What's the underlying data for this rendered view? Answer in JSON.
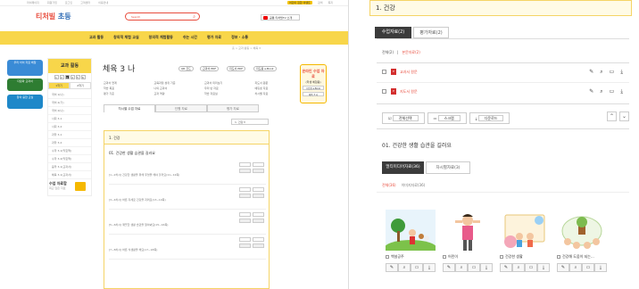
{
  "topbar": {
    "left_links": [
      "마이페이지",
      "회원가입",
      "로그인",
      "고객센터",
      "이용안내"
    ],
    "right_links": [
      "검색",
      "쪽지",
      "메일",
      "알림"
    ],
    "event": "어린이 집합 이벤트"
  },
  "logo": {
    "main": "티처빌",
    "sub": "초등"
  },
  "search": {
    "placeholder": "Search"
  },
  "youtube": {
    "label": "공통 티처빌TV 소개"
  },
  "nav": {
    "items": [
      "교과 활동",
      "창의적 체험 교실",
      "창의적 체험활동",
      "쉬는 시간",
      "평가 자료",
      "정보 · 소통"
    ]
  },
  "breadcrumb": "홈 > 교과 활동 > 체육 3",
  "promos": [
    {
      "label": "우리 아이 자료 배달"
    },
    {
      "label": "다문화 교과서"
    },
    {
      "label": "창의 융합 교실"
    }
  ],
  "side": {
    "header": "교과 활동",
    "grades": [
      "1",
      "2",
      "3",
      "4",
      "5",
      "6"
    ],
    "active_grade": "3",
    "tabs": [
      "1학기",
      "2학기"
    ],
    "items": [
      "국어 1(나)",
      "국어 2(가)",
      "국어 2(나)",
      "사회 3-1",
      "사회 3-2",
      "과학 3-1",
      "과학 3-2",
      "수학 3-1(익힘책)",
      "수학 3-2(익힘책)",
      "음악 3-1(교과서)",
      "체육 3-1(교과서)"
    ],
    "resources_title": "수업 자료함",
    "resources_sub": "최근 담은 자료"
  },
  "main": {
    "title": "체육 3 나",
    "pills": [
      "QR 코드",
      "교과서 PDF",
      "지도서 PDF",
      "지도용 e-Book"
    ],
    "meta_rows": [
      [
        "교과서 연계",
        "교육과정 성취 기준",
        "교과서 미리보기",
        "지도서 원문"
      ],
      [
        "학습 목표",
        "나의 교과서",
        "우리 반 자료",
        "에듀넷 자료"
      ],
      [
        "평가 기준",
        "교과 역량",
        "학습 자료실",
        "차시별 자료"
      ]
    ],
    "lesson_box": {
      "title": "온라인 수업 자료",
      "sub": "(학생 체험용)",
      "btn1": "수업용 e-Book",
      "btn2": "체육 3 나"
    },
    "tabs": [
      "차시별 수업 자료",
      "단원 자료",
      "평가 자료"
    ],
    "select": "1. 건강",
    "unit": "1. 건강",
    "subtitle": "01. 건강한 생활 습관을 길러요",
    "items": [
      "[1~2차시] 건강한 생활을 위해 무엇을 해야 할까요(11~12쪽)",
      "[3~4차시] 바른 자세로 건강을 지켜요(13~14쪽)",
      "[5~6차시] 깨끗한 생활 습관을 알아봐요(15~16쪽)",
      "[7~8차시] 바른 식생활을 해요(17~18쪽)"
    ]
  },
  "right": {
    "header": "1. 건강",
    "tabs": [
      "수업자료(2)",
      "평가자료(2)"
    ],
    "filter_all": "전체(2)",
    "filter_main": "본문자료(2)",
    "files": [
      "교과서 원문",
      "지도서 원문"
    ],
    "buttons": [
      "전체선택",
      "스크랩",
      "다운로드"
    ],
    "subtitle": "01. 건강한 생활 습관을 길러요",
    "media_tabs": [
      "멀티미디어자료(36)",
      "차시별자료(3)"
    ],
    "media_filter_all": "전체(36)",
    "media_filter_2": "이미지자료(36)",
    "cards": [
      "백설공주",
      "어린이",
      "건강한 생활",
      "건강해 도움이 되는..."
    ]
  }
}
